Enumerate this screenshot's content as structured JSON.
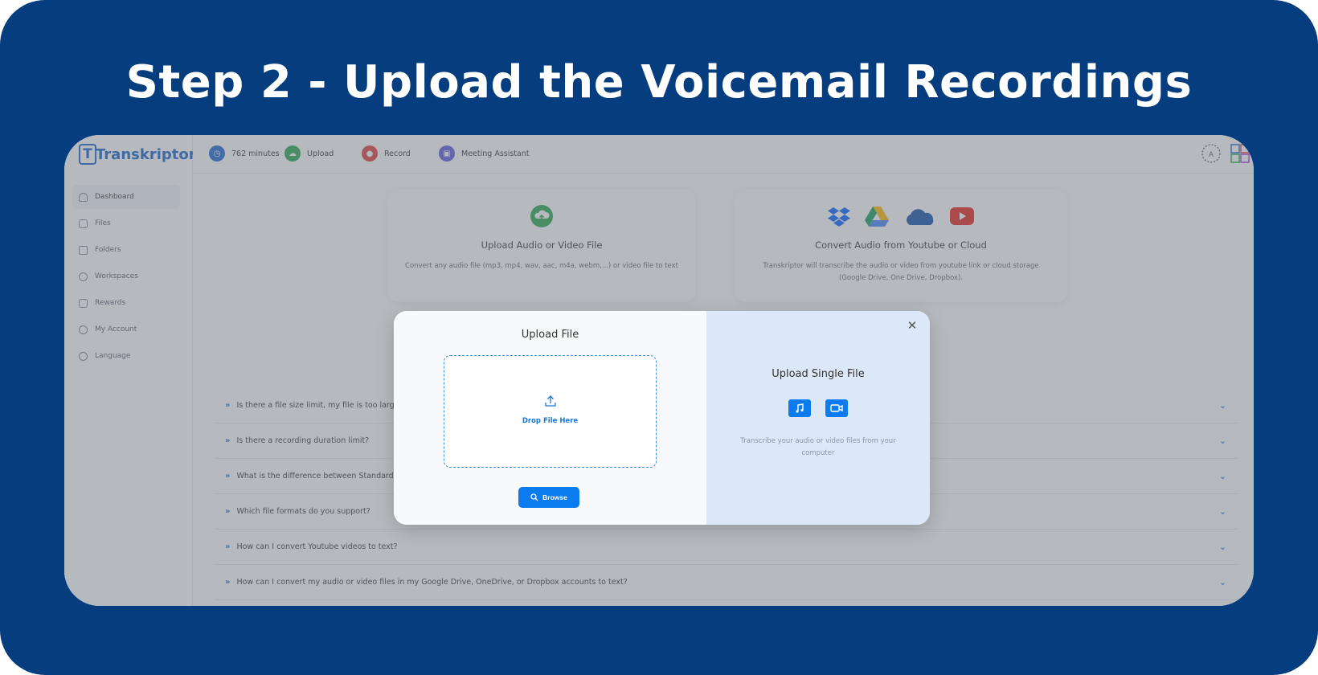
{
  "heading": "Step 2 - Upload the Voicemail Recordings",
  "colors": {
    "background": "#063d7e",
    "accent": "#0b7cf0",
    "upload_green": "#22a648",
    "record_red": "#e03a3a",
    "meeting_purple": "#5b57d6"
  },
  "app": {
    "logo": "Transkriptor",
    "sidebar": {
      "items": [
        {
          "label": "Dashboard",
          "icon": "gauge-icon"
        },
        {
          "label": "Files",
          "icon": "file-icon"
        },
        {
          "label": "Folders",
          "icon": "folder-icon"
        },
        {
          "label": "Workspaces",
          "icon": "users-icon"
        },
        {
          "label": "Rewards",
          "icon": "gift-icon"
        },
        {
          "label": "My Account",
          "icon": "user-icon"
        },
        {
          "label": "Language",
          "icon": "language-icon"
        }
      ]
    },
    "topbar": {
      "minutes": "762 minutes",
      "upload": "Upload",
      "record": "Record",
      "meeting": "Meeting Assistant"
    },
    "cards": [
      {
        "title": "Upload Audio or Video File",
        "desc": "Convert any audio file (mp3, mp4, wav, aac, m4a, webm,...) or video file to text"
      },
      {
        "title": "Convert Audio from Youtube or Cloud",
        "desc": "Transkriptor will transcribe the audio or video from youtube link or cloud storage (Google Drive, One Drive, Dropbox)."
      }
    ],
    "faq": [
      "Is there a file size limit, my file is too large how",
      "Is there a recording duration limit?",
      "What is the difference between Standard, Subti",
      "Which file formats do you support?",
      "How can I convert Youtube videos to text?",
      "How can I convert my audio or video files in my Google Drive, OneDrive, or Dropbox accounts to text?"
    ]
  },
  "modal": {
    "title": "Upload File",
    "drop_label": "Drop File Here",
    "browse": "Browse",
    "right_title": "Upload Single File",
    "right_desc": "Transcribe your audio or video files from your computer"
  }
}
